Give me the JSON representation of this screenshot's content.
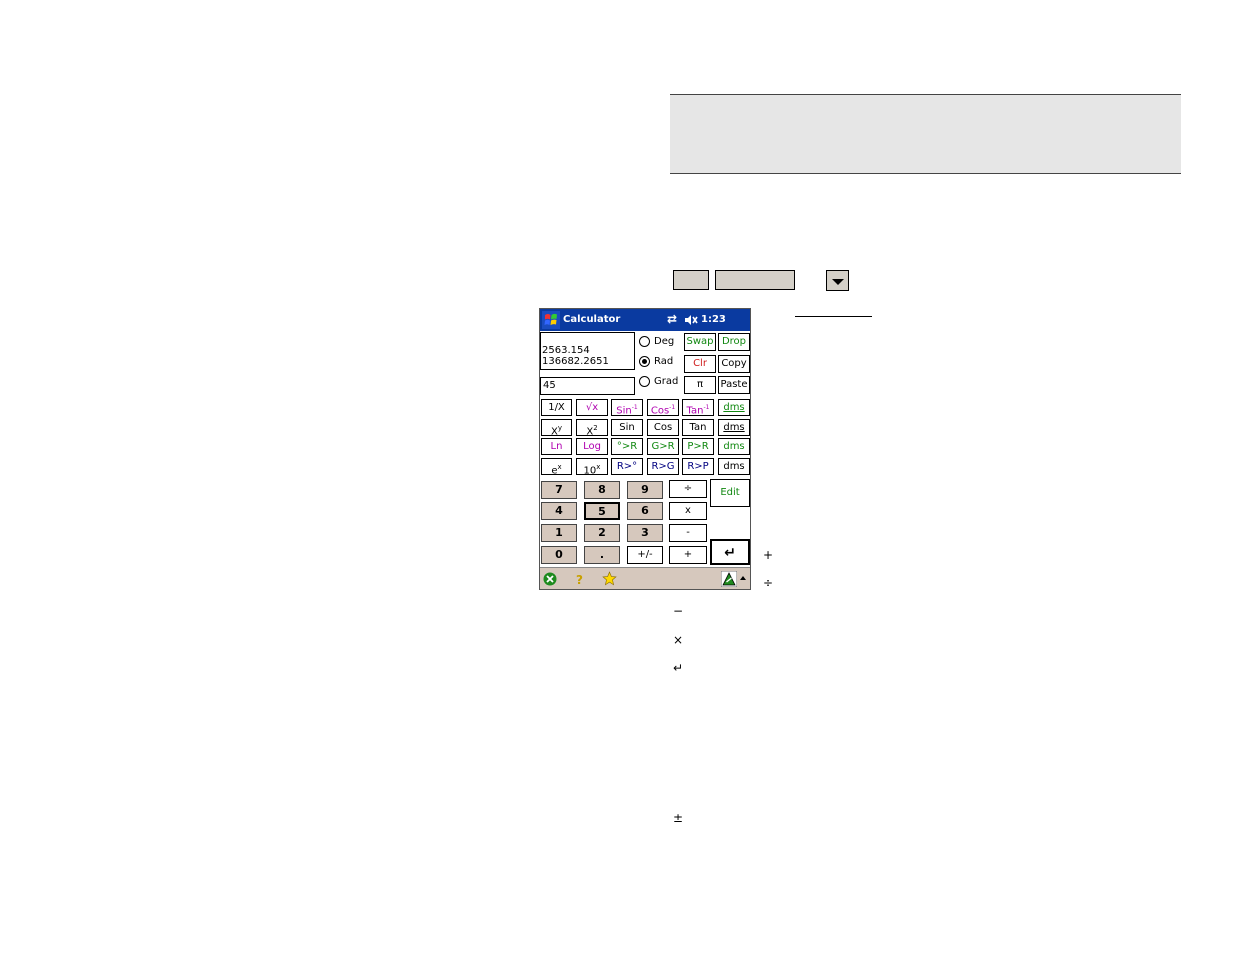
{
  "device": {
    "title": "Calculator",
    "status_time": "1:23",
    "display_lines": [
      "2563.154",
      "136682.2651"
    ],
    "entry_value": "45"
  },
  "angle_modes": [
    {
      "label": "Deg",
      "selected": false
    },
    {
      "label": "Rad",
      "selected": true
    },
    {
      "label": "Grad",
      "selected": false
    }
  ],
  "side_keys": {
    "swap": "Swap",
    "drop": "Drop",
    "clr": "Clr",
    "copy": "Copy",
    "pi": "π",
    "paste": "Paste"
  },
  "function_keys": {
    "row1": [
      "1/X",
      "√x",
      "Sin",
      "Cos",
      "Tan",
      "dms"
    ],
    "row2": [
      "X",
      "X",
      "Sin",
      "Cos",
      "Tan",
      "dms"
    ],
    "row3": [
      "Ln",
      "Log",
      "°>R",
      "G>R",
      "P>R",
      "dms"
    ],
    "row4": [
      "e",
      "10",
      "R>°",
      "R>G",
      "R>P",
      "dms"
    ],
    "superscripts": {
      "x_y": "y",
      "x_2": "2",
      "e_x": "x",
      "ten_x": "x",
      "inv": "-1"
    }
  },
  "keypad": {
    "rows": [
      [
        "7",
        "8",
        "9"
      ],
      [
        "4",
        "5",
        "6"
      ],
      [
        "1",
        "2",
        "3"
      ],
      [
        "0",
        ".",
        "+/-"
      ]
    ],
    "ops": [
      "÷",
      "x",
      "-",
      "+"
    ],
    "edit": "Edit",
    "enter": "↵"
  },
  "doc_symbols": {
    "plus": "+",
    "divide": "÷",
    "minus": "−",
    "times": "×",
    "enter": "↵",
    "plusminus": "±"
  }
}
